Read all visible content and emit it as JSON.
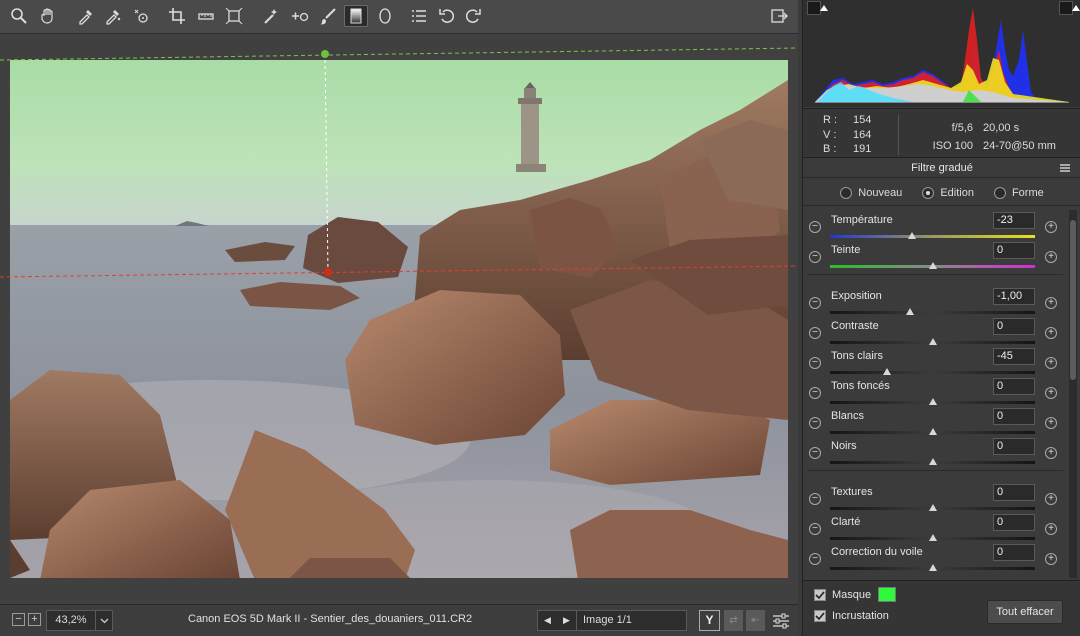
{
  "toolbar": {
    "tools": [
      {
        "name": "zoom-icon"
      },
      {
        "name": "hand-icon"
      },
      {
        "name": "eyedropper-white-balance-icon"
      },
      {
        "name": "color-sampler-icon"
      },
      {
        "name": "targeted-adjustment-icon"
      },
      {
        "name": "crop-icon"
      },
      {
        "name": "straighten-icon"
      },
      {
        "name": "transform-icon"
      },
      {
        "name": "spot-removal-icon"
      },
      {
        "name": "red-eye-icon"
      },
      {
        "name": "adjustment-brush-icon"
      },
      {
        "name": "graduated-filter-icon"
      },
      {
        "name": "radial-filter-icon"
      },
      {
        "name": "presets-list-icon"
      },
      {
        "name": "rotate-left-icon"
      },
      {
        "name": "rotate-right-icon"
      }
    ],
    "export_icon": "export-icon"
  },
  "statusbar": {
    "zoom_minus": "−",
    "zoom_plus": "+",
    "zoom_value": "43,2%",
    "filename": "Canon EOS 5D Mark II  -  Sentier_des_douaniers_011.CR2",
    "prev": "◀",
    "next": "▶",
    "image_count": "Image 1/1",
    "before_after_label": "Y"
  },
  "info": {
    "r_label": "R :",
    "r_value": "154",
    "v_label": "V :",
    "v_value": "164",
    "b_label": "B :",
    "b_value": "191",
    "aperture": "f/5,6",
    "shutter": "20,00 s",
    "iso": "ISO 100",
    "lens": "24-70@50 mm"
  },
  "panel": {
    "title": "Filtre gradué",
    "modes": [
      {
        "label": "Nouveau",
        "selected": false
      },
      {
        "label": "Edition",
        "selected": true
      },
      {
        "label": "Forme",
        "selected": false
      }
    ]
  },
  "sliders": [
    {
      "label": "Température",
      "value": "-23",
      "position": 0.4,
      "track": "temperature"
    },
    {
      "label": "Teinte",
      "value": "0",
      "position": 0.5,
      "track": "tint"
    },
    {
      "label": "Exposition",
      "value": "-1,00",
      "position": 0.39,
      "track": "plain"
    },
    {
      "label": "Contraste",
      "value": "0",
      "position": 0.5,
      "track": "plain"
    },
    {
      "label": "Tons clairs",
      "value": "-45",
      "position": 0.28,
      "track": "plain"
    },
    {
      "label": "Tons foncés",
      "value": "0",
      "position": 0.5,
      "track": "plain"
    },
    {
      "label": "Blancs",
      "value": "0",
      "position": 0.5,
      "track": "plain"
    },
    {
      "label": "Noirs",
      "value": "0",
      "position": 0.5,
      "track": "plain"
    },
    {
      "label": "Textures",
      "value": "0",
      "position": 0.5,
      "track": "plain"
    },
    {
      "label": "Clarté",
      "value": "0",
      "position": 0.5,
      "track": "plain"
    },
    {
      "label": "Correction du voile",
      "value": "0",
      "position": 0.5,
      "track": "plain"
    }
  ],
  "footer": {
    "mask_label": "Masque",
    "mask_checked": true,
    "mask_color": "#2dfa3a",
    "overlay_label": "Incrustation",
    "overlay_checked": true,
    "clear_button": "Tout effacer"
  },
  "colors": {
    "filter_top_line": "#7cc24a",
    "filter_bottom_line": "#e04030",
    "mask_tint": "#a8e8a0"
  }
}
